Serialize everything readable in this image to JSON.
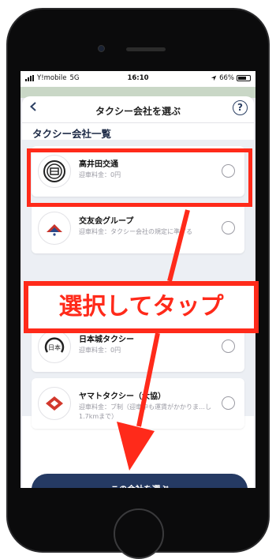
{
  "status_bar": {
    "carrier": "Y!mobile",
    "network": "5G",
    "time": "16:10",
    "battery_percent": "66%"
  },
  "header": {
    "title": "タクシー会社を選ぶ",
    "help_label": "?"
  },
  "list": {
    "heading": "タクシー会社一覧",
    "companies": [
      {
        "name": "高井田交通",
        "fee": "迎車料金：0円"
      },
      {
        "name": "交友会グループ",
        "fee": "迎車料金：タクシー会社の規定に準ずる"
      },
      {
        "name": "日本城タクシー",
        "fee": "迎車料金：0円"
      },
      {
        "name": "ヤマトタクシー（大協）",
        "fee": "迎車料金：ブ制（迎車中も運賃がかかりま…し1.7kmまで）"
      }
    ]
  },
  "cta": {
    "label": "この会社を選ぶ"
  },
  "annotation": {
    "callout_text": "選択してタップ",
    "accent_color": "#ff2a1a"
  },
  "colors": {
    "primary": "#253a63"
  }
}
